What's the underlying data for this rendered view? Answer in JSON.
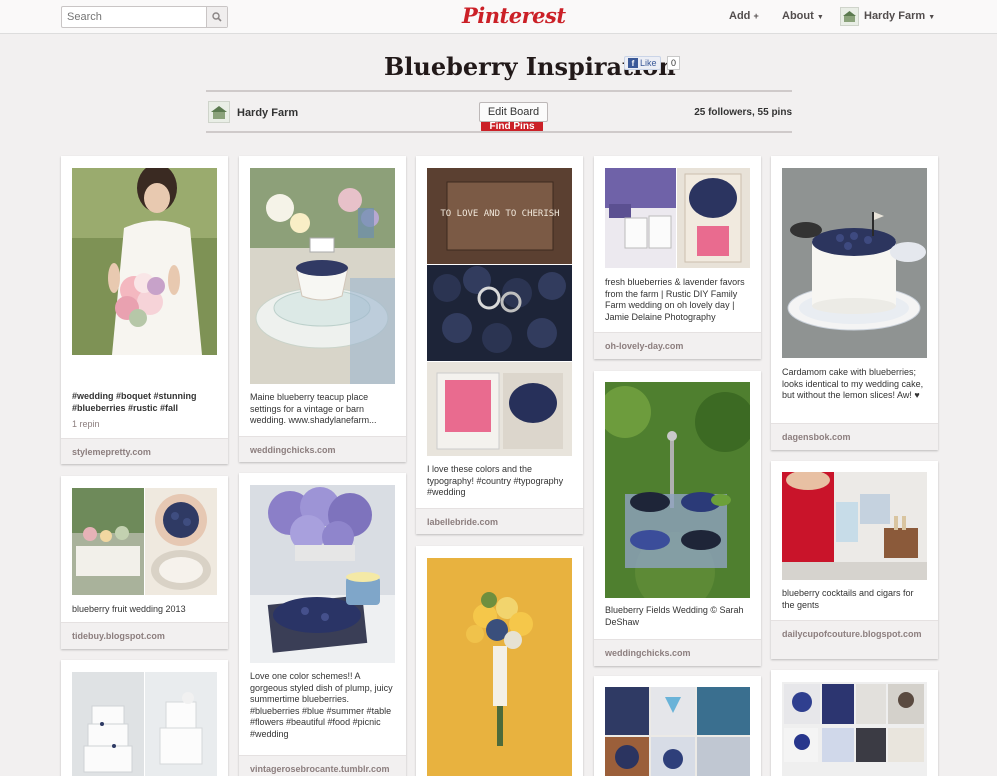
{
  "header": {
    "search_placeholder": "Search",
    "logo": "Pinterest",
    "add_label": "Add",
    "about_label": "About",
    "user_name": "Hardy Farm"
  },
  "board": {
    "title": "Blueberry Inspiration",
    "like_label": "Like",
    "like_count": "0",
    "owner": "Hardy Farm",
    "edit_label": "Edit Board",
    "find_pins_label": "Find Pins",
    "stats": "25 followers, 55 pins"
  },
  "pins": [
    {
      "desc": "#wedding #boquet #stunning #blueberries #rustic #fall",
      "repins": "1 repin",
      "source": "stylemepretty.com"
    },
    {
      "desc": "Maine blueberry teacup place settings for a vintage or barn wedding. www.shadylanefarm...",
      "source": "weddingchicks.com"
    },
    {
      "desc": "I love these colors and the typography! #country #typography #wedding",
      "source": "labellebride.com",
      "sign_text": "TO LOVE AND TO CHERISH"
    },
    {
      "desc": "fresh blueberries & lavender favors from the farm | Rustic DIY Family Farm wedding on oh lovely day | Jamie Delaine Photography",
      "source": "oh-lovely-day.com"
    },
    {
      "desc": "Cardamom cake with blueberries; looks identical to my wedding cake, but without the lemon slices! Aw! ♥",
      "source": "dagensbok.com"
    },
    {
      "desc": "blueberry fruit wedding 2013",
      "source": "tidebuy.blogspot.com"
    },
    {
      "desc": "Love one color schemes!! A gorgeous styled dish of plump, juicy summertime blueberries. #blueberries #blue #summer #table #flowers #beautiful #food #picnic #wedding",
      "source": "vintagerosebrocante.tumblr.com"
    },
    {
      "desc": "Blueberry Fields Wedding © Sarah DeShaw",
      "source": "weddingchicks.com"
    },
    {
      "desc": "blueberry cocktails and cigars for the gents",
      "source": "dailycupofcouture.blogspot.com"
    }
  ]
}
